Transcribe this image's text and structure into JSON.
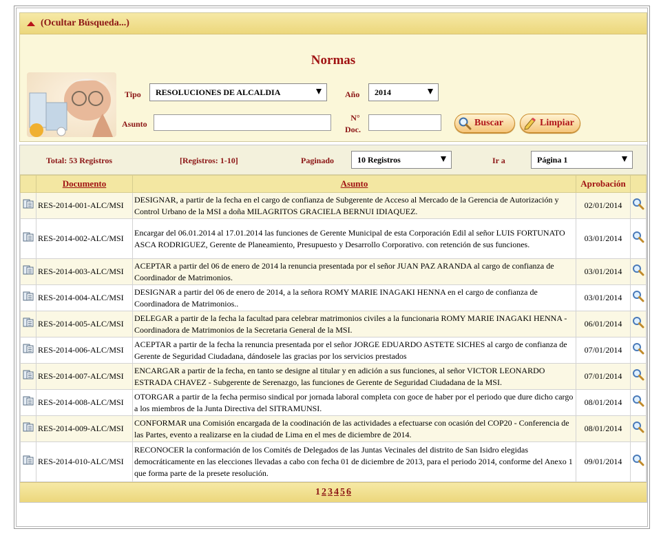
{
  "search": {
    "toggle_label": "(Ocultar Búsqueda...)",
    "title": "Normas",
    "tipo_label": "Tipo",
    "tipo_value": "RESOLUCIONES DE ALCALDIA",
    "anio_label": "Año",
    "anio_value": "2014",
    "asunto_label": "Asunto",
    "asunto_value": "",
    "ndoc_label_1": "N°",
    "ndoc_label_2": "Doc.",
    "ndoc_value": "",
    "buscar_label": "Buscar",
    "limpiar_label": "Limpiar"
  },
  "pagebar": {
    "total": "Total: 53 Registros",
    "range": "[Registros: 1-10]",
    "paginado_label": "Paginado",
    "paginado_value": "10 Registros",
    "ira_label": "Ir a",
    "ira_value": "Página 1"
  },
  "table": {
    "headers": {
      "documento": "Documento",
      "asunto": "Asunto",
      "aprobacion": "Aprobación"
    },
    "rows": [
      {
        "doc": "RES-2014-001-ALC/MSI",
        "asunto": "DESIGNAR, a partir de la fecha en el cargo de confianza de Subgerente de Acceso al Mercado de la Gerencia de Autorización y Control Urbano de la MSI a doña MILAGRITOS GRACIELA BERNUI IDIAQUEZ.",
        "fecha": "02/01/2014"
      },
      {
        "doc": "RES-2014-002-ALC/MSI",
        "asunto": "Encargar del 06.01.2014 al 17.01.2014 las funciones de Gerente Municipal de esta Corporación Edil al señor LUIS FORTUNATO ASCA RODRIGUEZ, Gerente de Planeamiento, Presupuesto y Desarrollo Corporativo. con retención de sus funciones.",
        "fecha": "03/01/2014"
      },
      {
        "doc": "RES-2014-003-ALC/MSI",
        "asunto": "ACEPTAR a partir del 06 de enero de 2014 la renuncia presentada por el señor JUAN PAZ ARANDA al cargo de confianza de Coordinador de Matrimonios.",
        "fecha": "03/01/2014"
      },
      {
        "doc": "RES-2014-004-ALC/MSI",
        "asunto": "DESIGNAR a partir del 06 de enero de 2014, a la señora ROMY MARIE INAGAKI HENNA en el cargo de confianza de Coordinadora de Matrimonios..",
        "fecha": "03/01/2014"
      },
      {
        "doc": "RES-2014-005-ALC/MSI",
        "asunto": "DELEGAR a partir de la fecha la facultad para celebrar matrimonios civiles a la funcionaria ROMY MARIE INAGAKI HENNA - Coordinadora de Matrimonios de la Secretaria General de la MSI.",
        "fecha": "06/01/2014"
      },
      {
        "doc": "RES-2014-006-ALC/MSI",
        "asunto": "ACEPTAR a partir de la fecha la renuncia presentada por el señor JORGE EDUARDO ASTETE SICHES al cargo de confianza de Gerente de Seguridad Ciudadana, dándosele las gracias por los servicios prestados",
        "fecha": "07/01/2014"
      },
      {
        "doc": "RES-2014-007-ALC/MSI",
        "asunto": "ENCARGAR a partir de la fecha, en tanto se designe al titular y en adición a sus funciones, al señor VICTOR LEONARDO ESTRADA CHAVEZ - Subgerente de Serenazgo, las funciones de Gerente de Seguridad Ciudadana de la MSI.",
        "fecha": "07/01/2014"
      },
      {
        "doc": "RES-2014-008-ALC/MSI",
        "asunto": "OTORGAR a partir de la fecha permiso sindical por jornada laboral completa con goce de haber por el periodo que dure dicho cargo a los miembros de la Junta Directiva del SITRAMUNSI.",
        "fecha": "08/01/2014"
      },
      {
        "doc": "RES-2014-009-ALC/MSI",
        "asunto": "CONFORMAR una Comisión encargada de la coodinación de las actividades a efectuarse con ocasión del COP20 - Conferencia de las Partes, evento a realizarse en la ciudad de Lima en el mes de diciembre de 2014.",
        "fecha": "08/01/2014"
      },
      {
        "doc": "RES-2014-010-ALC/MSI",
        "asunto": "RECONOCER la conformación de los Comités de Delegados de las Juntas Vecinales del distrito de San Isidro elegidas democráticamente en las elecciones llevadas a cabo con fecha 01 de diciembre de 2013, para el periodo 2014, conforme del Anexo 1 que forma parte de la presete resolución.",
        "fecha": "09/01/2014"
      }
    ]
  },
  "pagination": {
    "pages": [
      "1",
      "2",
      "3",
      "4",
      "5",
      "6"
    ],
    "current": "1"
  },
  "icons": {
    "row_doc": "document-icon",
    "row_view": "magnifier-icon",
    "buscar": "magnifier-icon",
    "limpiar": "pencil-icon"
  },
  "colors": {
    "accent": "#a01313",
    "header_bar": "#ecd77c",
    "panel_bg": "#fbf7d9"
  }
}
